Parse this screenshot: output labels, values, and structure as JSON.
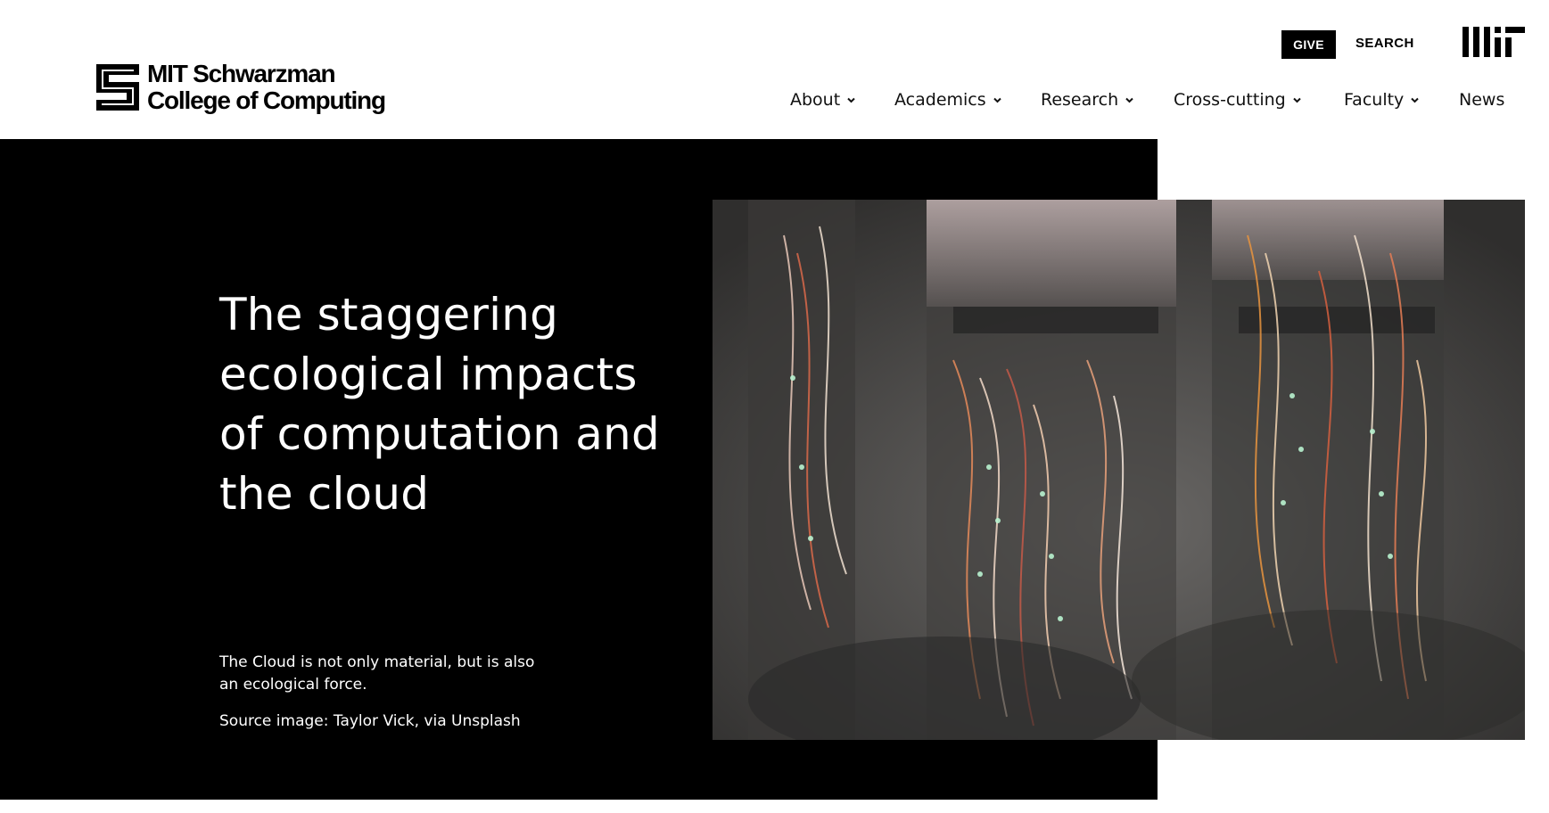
{
  "header": {
    "logo": {
      "line1": "MIT Schwarzman",
      "line2": "College of Computing",
      "icon": "schwarzman-s-logo-icon"
    },
    "utility": {
      "give_label": "GIVE",
      "search_label": "SEARCH",
      "mit_logo_icon": "mit-logo-icon"
    },
    "nav": [
      {
        "label": "About",
        "dropdown": true
      },
      {
        "label": "Academics",
        "dropdown": true
      },
      {
        "label": "Research",
        "dropdown": true
      },
      {
        "label": "Cross-cutting",
        "dropdown": true
      },
      {
        "label": "Faculty",
        "dropdown": true
      },
      {
        "label": "News",
        "dropdown": false
      }
    ]
  },
  "hero": {
    "headline": "The staggering ecological impacts of computation and the cloud",
    "dek": "The Cloud is not only material, but is also an ecological force.",
    "credit": "Source image: Taylor Vick, via Unsplash",
    "image_icon": "server-rack-cables-photo"
  },
  "colors": {
    "hero_background": "#000000",
    "page_background": "#ffffff",
    "give_button": "#000000"
  }
}
